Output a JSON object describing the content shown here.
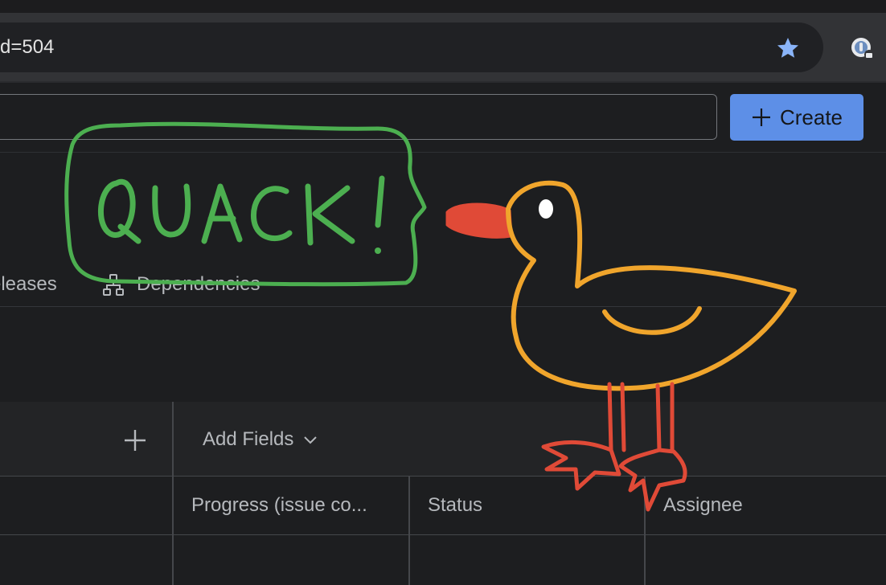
{
  "browser": {
    "address_text": "d=504",
    "bookmark_icon": "star-icon",
    "extension_icon": "extension-icon",
    "accent": "#5d8fe7"
  },
  "header": {
    "search_value": "",
    "create_label": "Create",
    "create_color": "#5d8fe7"
  },
  "tabs": [
    {
      "label": "eleases"
    },
    {
      "label": "Dependencies",
      "icon": "dependencies-icon"
    }
  ],
  "table": {
    "add_fields_label": "Add Fields",
    "columns": [
      {
        "label": "Progress (issue co..."
      },
      {
        "label": "Status"
      },
      {
        "label": "Assignee"
      }
    ]
  },
  "doodle": {
    "speech_text": "QUACK!",
    "bubble_color": "#4caf50",
    "duck_body_color": "#f0a52c",
    "duck_beak_color": "#e04a37"
  }
}
